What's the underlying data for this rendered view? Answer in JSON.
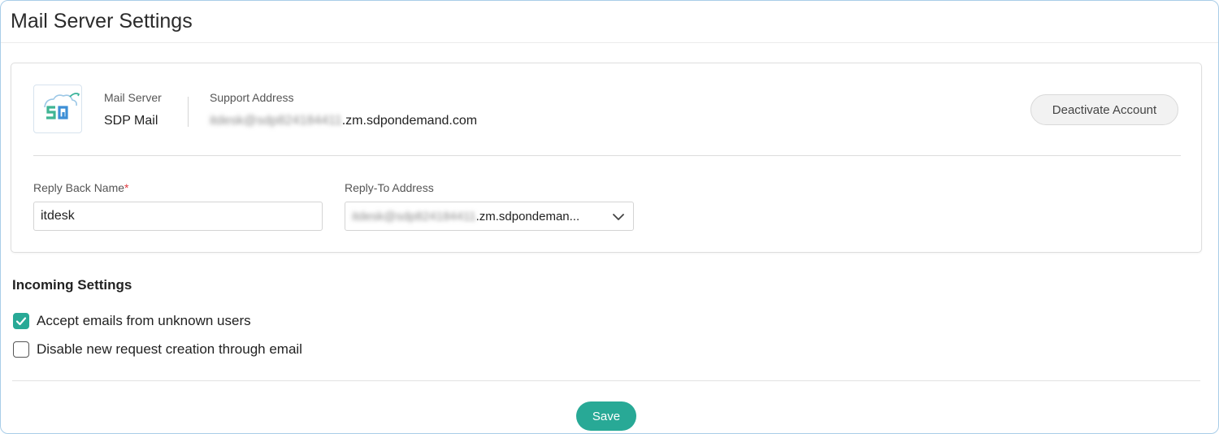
{
  "page": {
    "title": "Mail Server Settings"
  },
  "account": {
    "logo_icon": "sdp-mail-cloud-logo",
    "mail_server_label": "Mail Server",
    "mail_server_value": "SDP Mail",
    "support_address_label": "Support Address",
    "support_address_blurred": "itdesk@sdp824184411",
    "support_address_domain": ".zm.sdpondemand.com",
    "deactivate_label": "Deactivate Account"
  },
  "reply": {
    "name_label": "Reply Back Name",
    "required_marker": "*",
    "name_value": "itdesk",
    "address_label": "Reply-To Address",
    "address_blurred": "itdesk@sdp824184411",
    "address_domain": ".zm.sdpondemand.com",
    "address_display_domain": ".zm.sdpondeman...",
    "dropdown_icon": "chevron-down-icon"
  },
  "incoming": {
    "heading": "Incoming Settings",
    "options": [
      {
        "label": "Accept emails from unknown users",
        "checked": true
      },
      {
        "label": "Disable new request creation through email",
        "checked": false
      }
    ]
  },
  "footer": {
    "save_label": "Save"
  },
  "colors": {
    "accent": "#28a996",
    "required": "#e0393e",
    "frame_border": "#a9cde8"
  }
}
